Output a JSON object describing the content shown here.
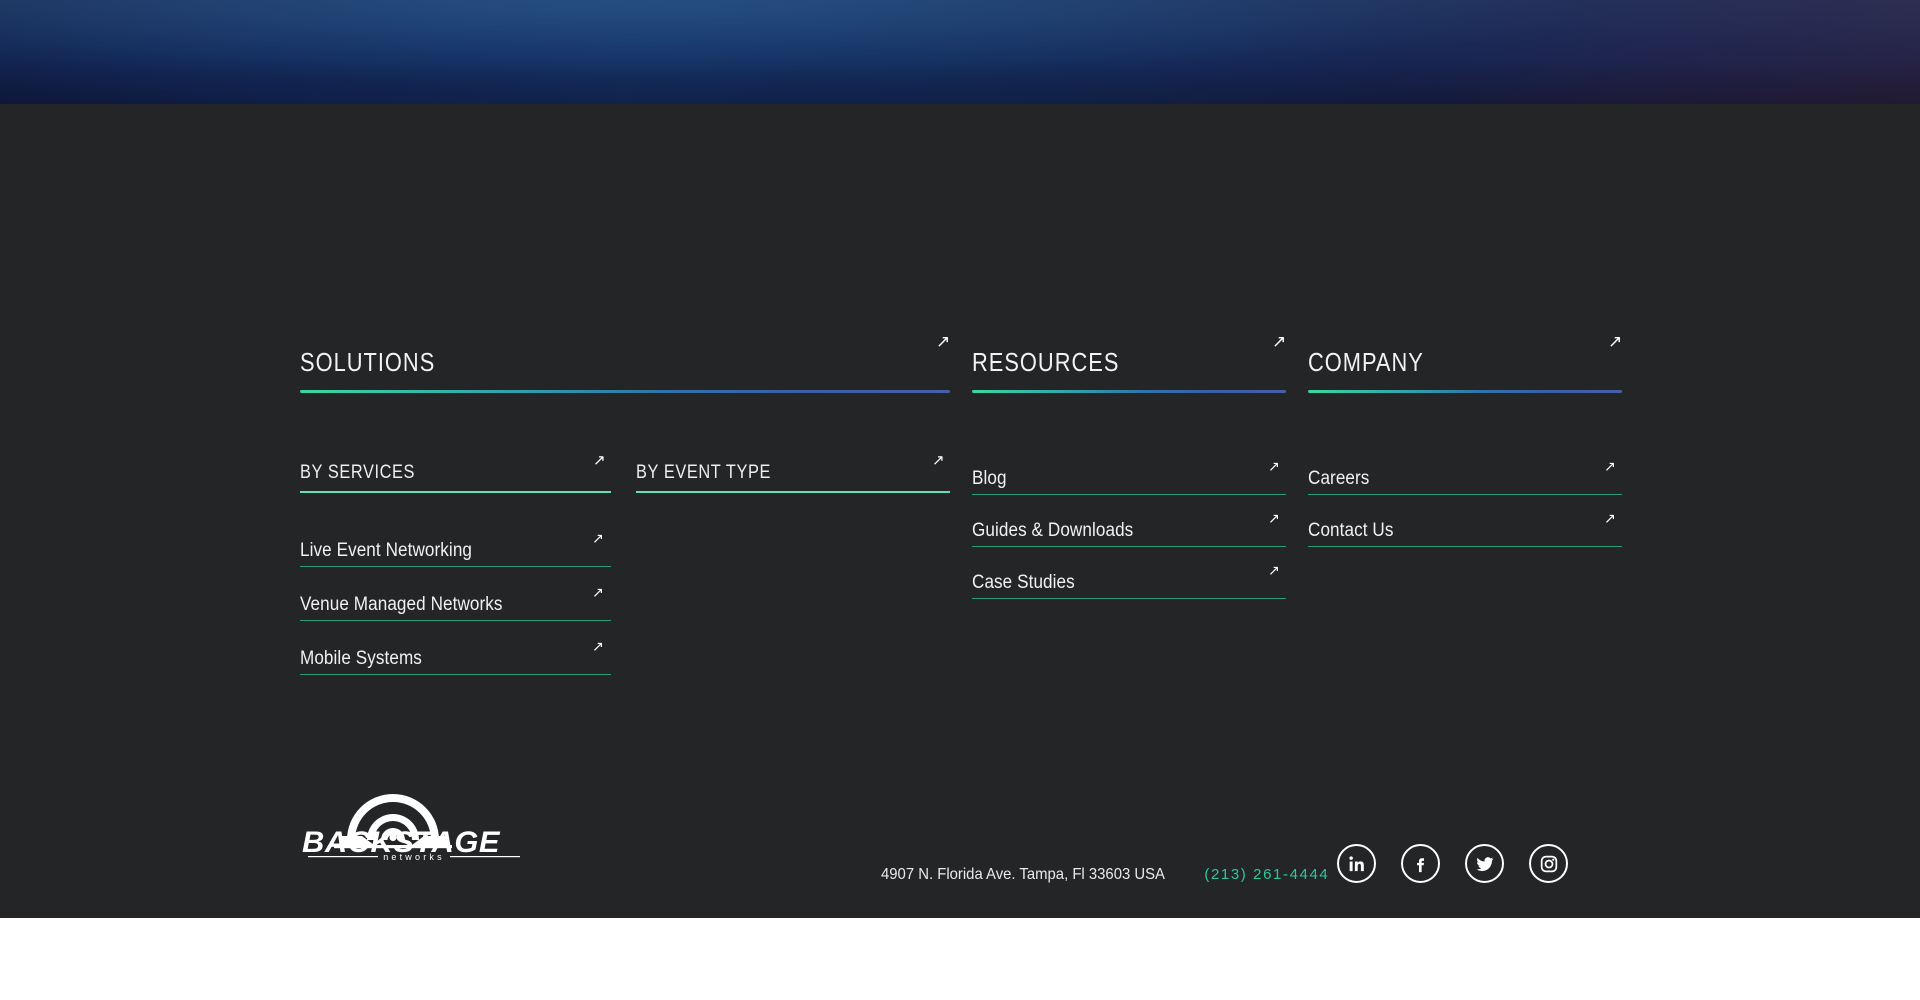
{
  "page": {
    "background_color": "#232527",
    "banner_colors": [
      "#13255c",
      "#16306c",
      "#2b2243"
    ],
    "accent_gradient": [
      "#3ad79d",
      "#2f9fae",
      "#4a5fa8"
    ],
    "accent_mint": "#5ee0bb",
    "accent_teal": "#2e9c79",
    "phone_color": "#2fc79a",
    "text_color": "#f0f1f2"
  },
  "arrow_icon": "↗",
  "footer": {
    "groups": [
      {
        "label": "SOLUTIONS",
        "arrow": "↗"
      },
      {
        "label": "RESOURCES",
        "arrow": "↗"
      },
      {
        "label": "COMPANY",
        "arrow": "↗"
      }
    ],
    "subgroups": [
      {
        "label": "BY SERVICES",
        "arrow": "↗"
      },
      {
        "label": "BY EVENT TYPE",
        "arrow": "↗"
      }
    ],
    "solutions_links": [
      {
        "label": "Live Event Networking",
        "arrow": "↗"
      },
      {
        "label": "Venue Managed Networks",
        "arrow": "↗"
      },
      {
        "label": "Mobile Systems",
        "arrow": "↗"
      }
    ],
    "event_type_links": [],
    "resources_links": [
      {
        "label": "Blog",
        "arrow": "↗"
      },
      {
        "label": "Guides & Downloads",
        "arrow": "↗"
      },
      {
        "label": "Case Studies",
        "arrow": "↗"
      }
    ],
    "company_links": [
      {
        "label": "Careers",
        "arrow": "↗"
      },
      {
        "label": "Contact Us",
        "arrow": "↗"
      }
    ],
    "logo": {
      "wordmark": "BACKSTAGE",
      "subtext": "networks"
    },
    "address": "4907 N. Florida Ave. Tampa, Fl 33603 USA",
    "phone": "(213) 261-4444",
    "social": [
      {
        "name": "linkedin-icon",
        "label": "LinkedIn"
      },
      {
        "name": "facebook-icon",
        "label": "Facebook"
      },
      {
        "name": "twitter-icon",
        "label": "Twitter"
      },
      {
        "name": "instagram-icon",
        "label": "Instagram"
      }
    ]
  }
}
